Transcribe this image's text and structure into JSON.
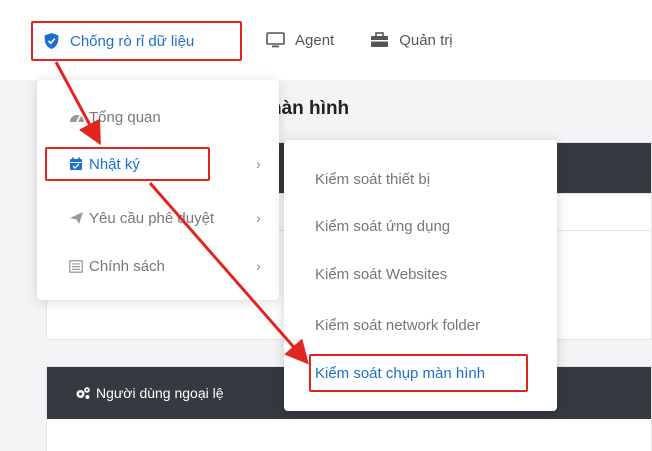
{
  "topnav": {
    "items": [
      {
        "label": "Chống rò rỉ dữ liệu",
        "icon": "shield-icon",
        "active": true
      },
      {
        "label": "Agent",
        "icon": "monitor-icon"
      },
      {
        "label": "Quản trị",
        "icon": "briefcase-icon"
      }
    ]
  },
  "page": {
    "title_fragment": "hàn hình",
    "section_heading_fragment": "Người dùng ngoại lệ"
  },
  "dropdown": {
    "items": [
      {
        "label": "Tổng quan",
        "icon": "dashboard-icon"
      },
      {
        "label": "Nhật ký",
        "icon": "calendar-icon",
        "active": true,
        "has_submenu": true
      },
      {
        "label": "Yêu cầu phê duyệt",
        "icon": "send-icon",
        "has_submenu": true
      },
      {
        "label": "Chính sách",
        "icon": "list-icon",
        "has_submenu": true
      }
    ],
    "chevron": "›"
  },
  "submenu": {
    "items": [
      {
        "label": "Kiểm soát thiết bị"
      },
      {
        "label": "Kiểm soát ứng dụng"
      },
      {
        "label": "Kiểm soát Websites"
      },
      {
        "label": "Kiểm soát network folder"
      },
      {
        "label": "Kiểm soát chụp màn hình",
        "active": true
      }
    ]
  },
  "colors": {
    "accent": "#1a6fd1",
    "highlight": "#e3251f",
    "dark_header": "#343a40"
  }
}
